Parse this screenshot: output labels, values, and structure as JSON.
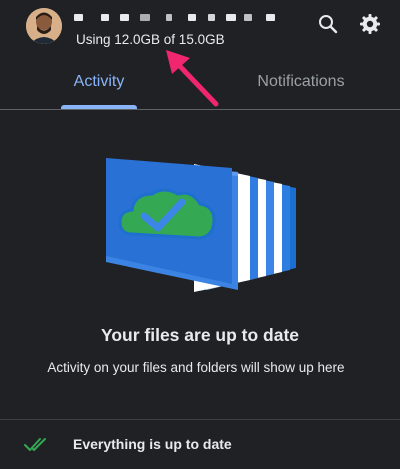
{
  "header": {
    "storage_text": "Using 12.0GB of 15.0GB",
    "search_icon": "search-icon",
    "settings_icon": "gear-icon"
  },
  "tabs": [
    {
      "label": "Activity",
      "active": true
    },
    {
      "label": "Notifications",
      "active": false
    }
  ],
  "empty_state": {
    "illustration": "cloud-check-folders-illustration",
    "title": "Your files are up to date",
    "subtitle": "Activity on your files and folders will show up here"
  },
  "footer": {
    "icon": "double-check-icon",
    "status_text": "Everything is up to date"
  },
  "colors": {
    "background": "#202124",
    "accent": "#8ab4f8",
    "annotation_arrow": "#f0266f",
    "success_green": "#34a853"
  }
}
